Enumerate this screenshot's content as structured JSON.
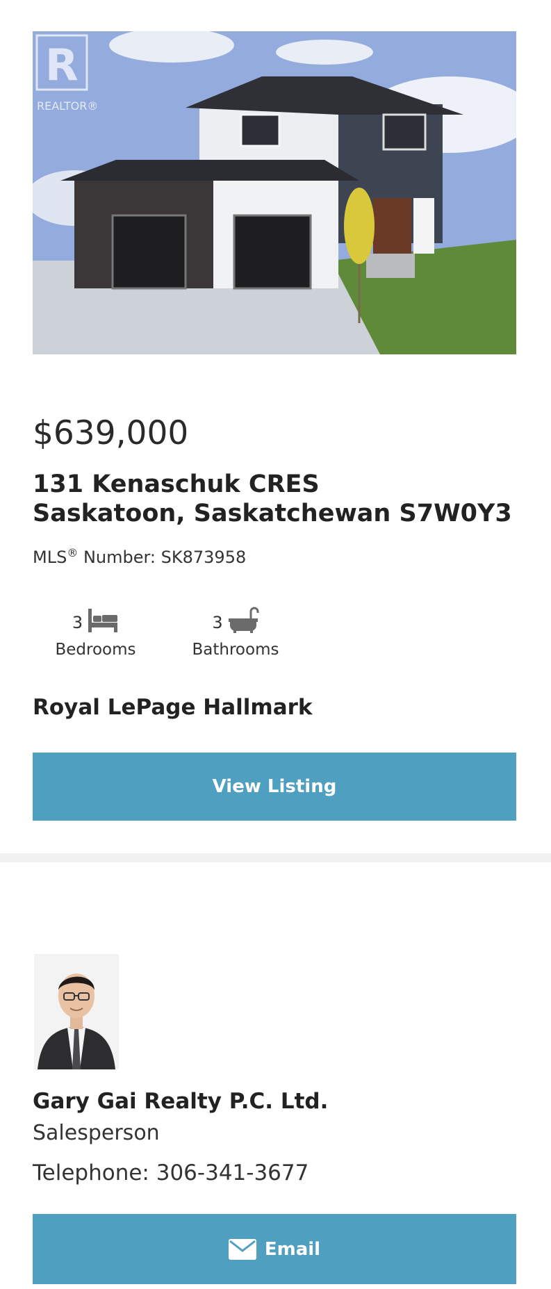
{
  "listing": {
    "photo_alt": "House listing photo",
    "watermark": "REALTOR®",
    "price": "$639,000",
    "address_line1": "131 Kenaschuk CRES",
    "address_line2": "Saskatoon, Saskatchewan S7W0Y3",
    "mls_prefix": "MLS",
    "mls_reg": "®",
    "mls_suffix": " Number: SK873958",
    "bedrooms": {
      "count": "3",
      "label": "Bedrooms",
      "icon": "bed-icon"
    },
    "bathrooms": {
      "count": "3",
      "label": "Bathrooms",
      "icon": "bathtub-icon"
    },
    "office": "Royal LePage Hallmark",
    "view_button": "View Listing"
  },
  "agent": {
    "name": "Gary Gai Realty P.C. Ltd.",
    "title": "Salesperson",
    "phone": "Telephone: 306-341-3677",
    "email_button": "Email",
    "email_icon": "envelope-icon"
  },
  "colors": {
    "button_bg": "#4f9fc0",
    "page_bg": "#f1f1f1",
    "icon_gray": "#6b6b6b"
  }
}
